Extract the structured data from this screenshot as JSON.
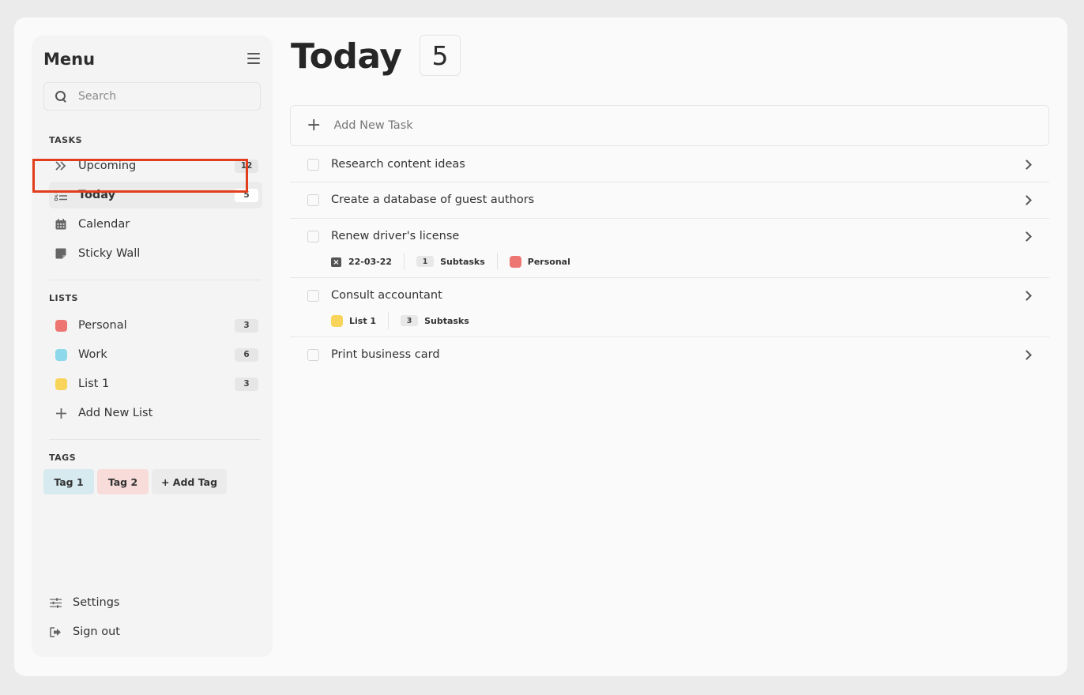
{
  "sidebar": {
    "title": "Menu",
    "search_placeholder": "Search",
    "tasks_header": "TASKS",
    "tasks": [
      {
        "label": "Upcoming",
        "count": "12",
        "icon": "double-chevron-right-icon"
      },
      {
        "label": "Today",
        "count": "5",
        "icon": "checklist-icon",
        "active": true
      },
      {
        "label": "Calendar",
        "count": "",
        "icon": "calendar-icon"
      },
      {
        "label": "Sticky Wall",
        "count": "",
        "icon": "sticky-note-icon"
      }
    ],
    "lists_header": "LISTS",
    "lists": [
      {
        "label": "Personal",
        "count": "3",
        "color": "#ee7672"
      },
      {
        "label": "Work",
        "count": "6",
        "color": "#8dd8ea"
      },
      {
        "label": "List 1",
        "count": "3",
        "color": "#f8d55a"
      }
    ],
    "add_list_label": "Add New List",
    "tags_header": "TAGS",
    "tags": [
      {
        "label": "Tag 1",
        "color": "#d6eaef"
      },
      {
        "label": "Tag 2",
        "color": "#f7dcd9"
      },
      {
        "label": "+ Add Tag",
        "color": "#ebebeb"
      }
    ],
    "settings_label": "Settings",
    "signout_label": "Sign out"
  },
  "main": {
    "title": "Today",
    "count": "5",
    "add_task_label": "Add New Task",
    "tasks": [
      {
        "label": "Research content ideas"
      },
      {
        "label": "Create a database of guest authors"
      },
      {
        "label": "Renew driver's license",
        "date": "22-03-22",
        "subtasks_count": "1",
        "subtasks_label": "Subtasks",
        "list": "Personal",
        "list_color": "#ee7672"
      },
      {
        "label": "Consult accountant",
        "list": "List 1",
        "list_color": "#f8d55a",
        "subtasks_count": "3",
        "subtasks_label": "Subtasks"
      },
      {
        "label": "Print business card"
      }
    ]
  }
}
